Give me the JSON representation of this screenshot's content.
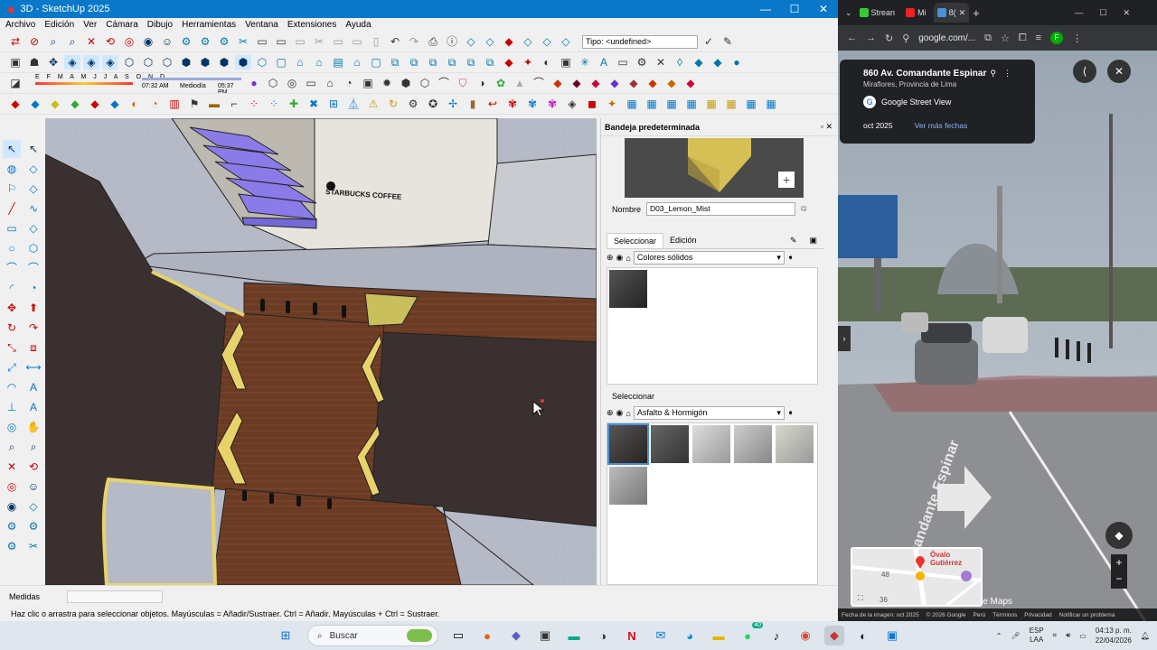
{
  "sketchup": {
    "title": "3D - SketchUp 2025",
    "window_controls": [
      "—",
      "☐",
      "✕"
    ],
    "menu": [
      "Archivo",
      "Edición",
      "Ver",
      "Cámara",
      "Dibujo",
      "Herramientas",
      "Ventana",
      "Extensiones",
      "Ayuda"
    ],
    "tag_field": "Tipo: <undefined>",
    "shadow_months": "E F M A M J J A S O N D",
    "shadow_time_start": "07:32 AM",
    "shadow_time_mid": "Mediodía",
    "shadow_time_end": "05:37 PM",
    "storefront_sign": "STARBUCKS COFFEE",
    "tray": {
      "title": "Bandeja predeterminada",
      "name_label": "Nombre",
      "name_value": "D03_Lemon_Mist",
      "tab_select": "Seleccionar",
      "tab_edit": "Edición",
      "library1": "Colores sólidos",
      "section2_label": "Seleccionar",
      "library2": "Asfalto & Hormigón"
    },
    "status": {
      "measure_label": "Medidas",
      "hint": "Haz clic o arrastra para seleccionar objetos. Mayúsculas = Añadir/Sustraer. Ctrl = Añadir. Mayúsculas + Ctrl = Sustraer."
    }
  },
  "chrome": {
    "tabs": [
      "Strean",
      "Mi",
      "8("
    ],
    "url": "google.com/...",
    "street_view": {
      "address": "860 Av. Comandante Espinar",
      "locality": "Miraflores, Provincia de Lima",
      "service": "Google Street View",
      "date": "oct 2025",
      "more_dates": "Ver más fechas",
      "road_label": "Av. Comandante Espinar",
      "map_place": "Óvalo Gutiérrez",
      "map_numbers": [
        "48",
        "36"
      ],
      "maps_brand": "le Maps",
      "footer": [
        "Fecha de la imagen: oct 2025",
        "© 2026 Google",
        "Perú",
        "Términos",
        "Privacidad",
        "Notificar un problema"
      ]
    }
  },
  "taskbar": {
    "search": "Buscar",
    "lang": "ESP",
    "lang2": "LAA",
    "time": "04:13 p. m.",
    "date": "22/04/2026",
    "badge": "40"
  },
  "colors": {
    "su_title": "#0a78c8",
    "lemon": "#e8d36a",
    "asphalt": "#3a3030",
    "wood": "#6b3b24",
    "concrete": "#b5bac6"
  }
}
